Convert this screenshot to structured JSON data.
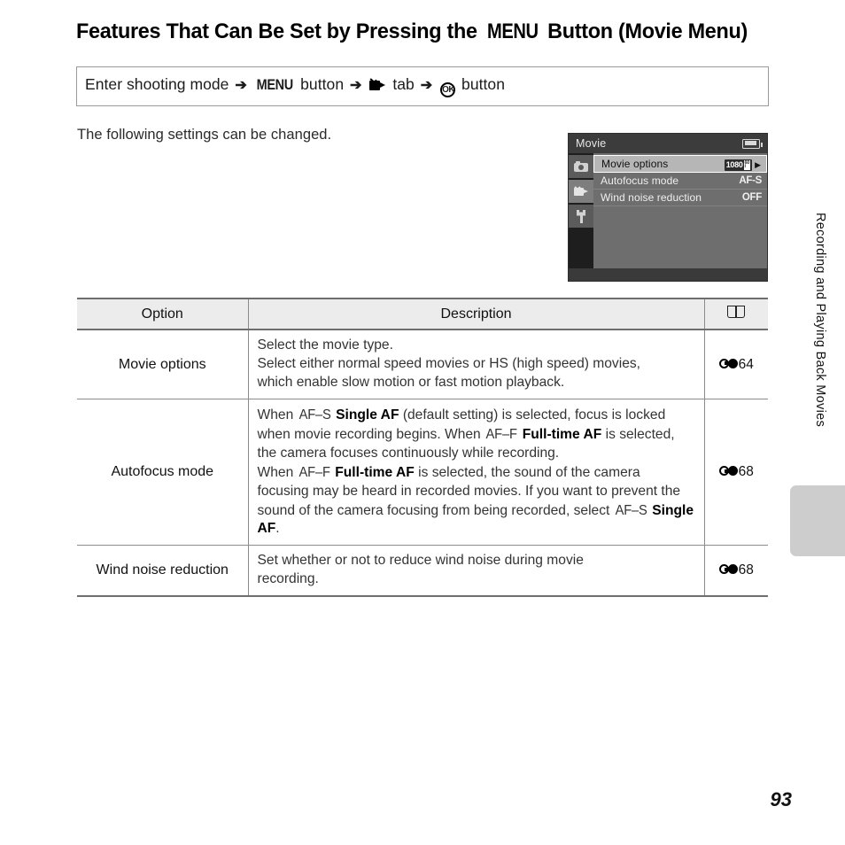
{
  "document": {
    "title_prefix": "Features That Can Be Set by Pressing the ",
    "title_menu_glyph": "MENU",
    "title_suffix": " Button (Movie Menu)",
    "page_number": "93",
    "side_tab_text": "Recording and Playing Back Movies"
  },
  "instruction": {
    "step1": "Enter shooting mode",
    "arrow": "➔",
    "menu_label": "MENU",
    "step2": " button",
    "tab_icon": "movie-camera-icon",
    "step3": " tab",
    "ok_label": "OK",
    "step4": " button"
  },
  "intro": {
    "text": "The following settings can be changed."
  },
  "lcd": {
    "title": "Movie",
    "battery_icon": "battery-icon",
    "tabs": [
      {
        "icon": "still-camera-icon",
        "active": false
      },
      {
        "icon": "movie-camera-icon",
        "active": true
      },
      {
        "icon": "wrench-icon",
        "active": false
      }
    ],
    "rows": [
      {
        "label": "Movie options",
        "value": "1080",
        "value_sub_top": "60",
        "value_sub_bottom": "i",
        "selected": true,
        "badge": true
      },
      {
        "label": "Autofocus mode",
        "value": "AF-S",
        "selected": false,
        "badge": false
      },
      {
        "label": "Wind noise reduction",
        "value": "OFF",
        "selected": false,
        "badge": false
      }
    ]
  },
  "table": {
    "headers": {
      "option": "Option",
      "description": "Description",
      "reference": "book-icon"
    },
    "rows": [
      {
        "option": "Movie options",
        "description_lines": [
          "Select the movie type.",
          "Select either normal speed movies or HS (high speed) movies,",
          "which enable slow motion or fast motion playback."
        ],
        "ref_symbol": "reference-section-icon",
        "ref_page": "64"
      },
      {
        "option": "Autofocus mode",
        "description_html": "When <span class=\"afg\">AF–S</span> <b class=\"bb\">Single AF</b> (default setting) is selected, focus is locked when movie recording begins. When <span class=\"afg\">AF–F</span> <b class=\"bb\">Full-time AF</b> is selected, the camera focuses continuously while recording.<br>When <span class=\"afg\">AF–F</span> <b class=\"bb\">Full-time AF</b> is selected, the sound of the camera focusing may be heard in recorded movies. If you want to prevent the sound of the camera focusing from being recorded, select <span class=\"afg\">AF–S</span> <b class=\"bb\">Single AF</b>.",
        "ref_symbol": "reference-section-icon",
        "ref_page": "68"
      },
      {
        "option": "Wind noise reduction",
        "description_lines": [
          "Set whether or not to reduce wind noise during movie",
          "recording."
        ],
        "ref_symbol": "reference-section-icon",
        "ref_page": "68"
      }
    ]
  },
  "colors": {
    "header_bg": "#ececec",
    "rule": "#6e6e6e",
    "lcd_bg": "#6e6e6e",
    "side_tab": "#cdcdcd"
  }
}
